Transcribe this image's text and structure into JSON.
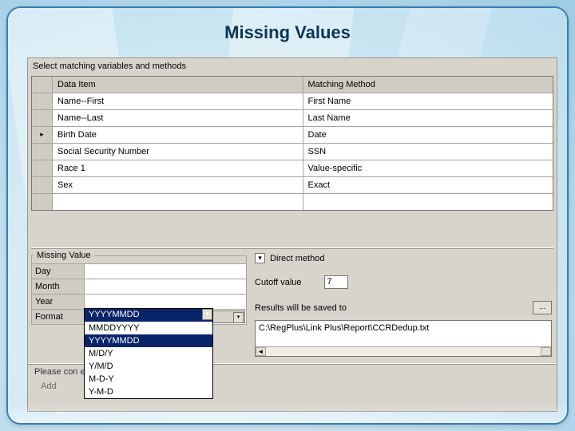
{
  "title": "Missing Values",
  "section_label": "Select matching variables and methods",
  "grid": {
    "headers": {
      "selector": "",
      "data_item": "Data Item",
      "matching_method": "Matching Method"
    },
    "rows": [
      {
        "marker": "",
        "data_item": "Name--First",
        "method": "First Name"
      },
      {
        "marker": "",
        "data_item": "Name--Last",
        "method": "Last Name"
      },
      {
        "marker": "▸",
        "data_item": "Birth Date",
        "method": "Date"
      },
      {
        "marker": "",
        "data_item": "Social Security Number",
        "method": "SSN"
      },
      {
        "marker": "",
        "data_item": "Race 1",
        "method": "Value-specific"
      },
      {
        "marker": "",
        "data_item": "Sex",
        "method": "Exact"
      },
      {
        "marker": "",
        "data_item": "",
        "method": ""
      }
    ]
  },
  "missing_value": {
    "legend": "Missing Value",
    "labels": {
      "day": "Day",
      "month": "Month",
      "year": "Year",
      "format": "Format"
    },
    "values": {
      "day": "",
      "month": "",
      "year": "",
      "format": "YYYYMMDD"
    },
    "dropdown_arrow": "▾",
    "options": [
      "MMDDYYYY",
      "YYYYMMDD",
      "M/D/Y",
      "Y/M/D",
      "M-D-Y",
      "Y-M-D"
    ],
    "selected_index": 1,
    "add_label": "Add"
  },
  "right": {
    "direct_method_checked": "▾",
    "direct_method_label": "Direct method",
    "cutoff_label": "Cutoff value",
    "cutoff_value": "7",
    "saved_label": "Results will be saved to",
    "browse_label": "...",
    "results_path": "C:\\RegPlus\\Link Plus\\Report\\CCRDedup.txt",
    "scroll_left": "◄",
    "scroll_right": " "
  },
  "confirm_text": "Please con                                                                en click the Run button."
}
